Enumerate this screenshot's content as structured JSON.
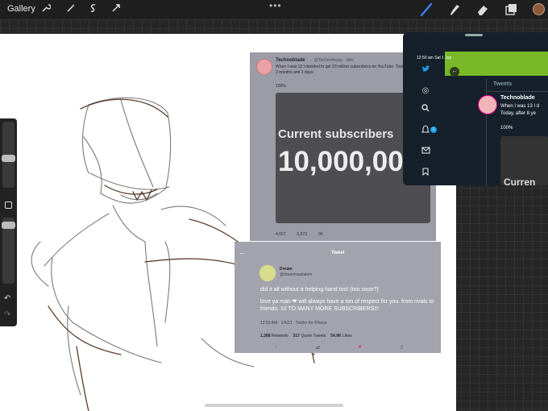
{
  "toolbar": {
    "gallery_label": "Gallery",
    "left_tools": [
      "wrench-icon",
      "magic-wand-icon",
      "selection-icon",
      "transform-icon"
    ],
    "right_tools": [
      "brush-icon",
      "smudge-icon",
      "eraser-icon",
      "layers-icon"
    ],
    "accent_color": "#3b82f6",
    "current_color": "#8a5a3a"
  },
  "reference1": {
    "name": "Technoblade",
    "handle": "@Technothepig · 48m",
    "tweet_text": "When I was 13 I decided to get 10 million subscribers on YouTube. Today, after 8 years, 2 months and 3 days:",
    "percent": "100%",
    "card_line1": "Current subscribers",
    "card_line2": "10,000,00",
    "stats": [
      "4,607",
      "5,873",
      "9K"
    ]
  },
  "reference2": {
    "header_title": "Tweet",
    "name": "Dream",
    "handle": "@dreamwastaken",
    "line1": "did it all without a helping hand too! (too soon?)",
    "line2": "love ya man ❤ will always have a ton of respect for you. from rivals to friends. 10 TO MANY MORE SUBSCRIBERS!!!",
    "meta": "12:50 AM · 1/4/21 · Twitter for iPhone",
    "retweets": "1,388",
    "retweets_label": "Retweets",
    "quotes": "517",
    "quotes_label": "Quote Tweets",
    "likes": "54.9K",
    "likes_label": "Likes"
  },
  "twitter": {
    "status_bar": "12:50 am   Sat 1 Jan",
    "tweets_label": "Tweets",
    "name": "Technoblade",
    "text_line1": "When I was 13 I d",
    "text_line2": "Today, after 8 ye",
    "percent": "100%",
    "image_text": "Curren",
    "badge": "1",
    "nav_icons": [
      "twitter-bird-icon",
      "fleets-icon",
      "search-icon",
      "notifications-icon",
      "messages-icon",
      "bookmarks-icon"
    ]
  }
}
